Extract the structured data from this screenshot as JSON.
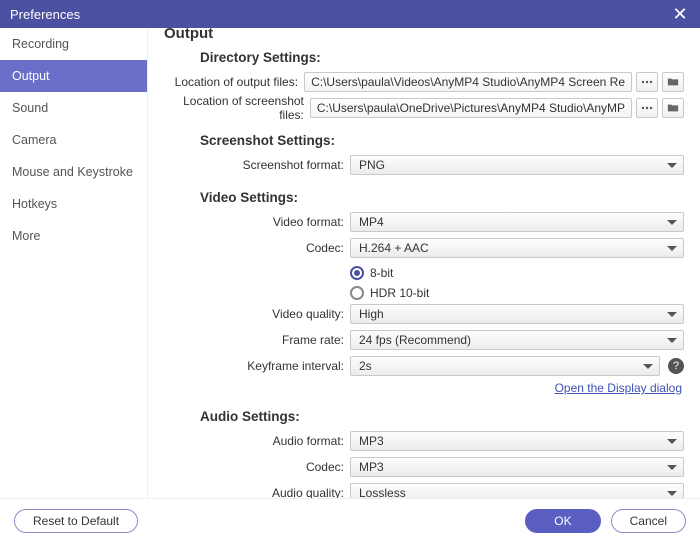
{
  "window": {
    "title": "Preferences"
  },
  "sidebar": {
    "items": [
      {
        "label": "Recording",
        "active": false
      },
      {
        "label": "Output",
        "active": true
      },
      {
        "label": "Sound",
        "active": false
      },
      {
        "label": "Camera",
        "active": false
      },
      {
        "label": "Mouse and Keystroke",
        "active": false
      },
      {
        "label": "Hotkeys",
        "active": false
      },
      {
        "label": "More",
        "active": false
      }
    ]
  },
  "page": {
    "title": "Output"
  },
  "directory": {
    "header": "Directory Settings:",
    "output_label": "Location of output files:",
    "output_path": "C:\\Users\\paula\\Videos\\AnyMP4 Studio\\AnyMP4 Screen Re",
    "screenshot_label": "Location of screenshot files:",
    "screenshot_path": "C:\\Users\\paula\\OneDrive\\Pictures\\AnyMP4 Studio\\AnyMP"
  },
  "screenshot": {
    "header": "Screenshot Settings:",
    "format_label": "Screenshot format:",
    "format_value": "PNG"
  },
  "video": {
    "header": "Video Settings:",
    "format_label": "Video format:",
    "format_value": "MP4",
    "codec_label": "Codec:",
    "codec_value": "H.264 + AAC",
    "bit_option_a": "8-bit",
    "bit_option_b": "HDR 10-bit",
    "quality_label": "Video quality:",
    "quality_value": "High",
    "framerate_label": "Frame rate:",
    "framerate_value": "24 fps (Recommend)",
    "keyframe_label": "Keyframe interval:",
    "keyframe_value": "2s",
    "display_link": "Open the Display dialog"
  },
  "audio": {
    "header": "Audio Settings:",
    "format_label": "Audio format:",
    "format_value": "MP3",
    "codec_label": "Codec:",
    "codec_value": "MP3",
    "quality_label": "Audio quality:",
    "quality_value": "Lossless"
  },
  "footer": {
    "reset": "Reset to Default",
    "ok": "OK",
    "cancel": "Cancel"
  }
}
